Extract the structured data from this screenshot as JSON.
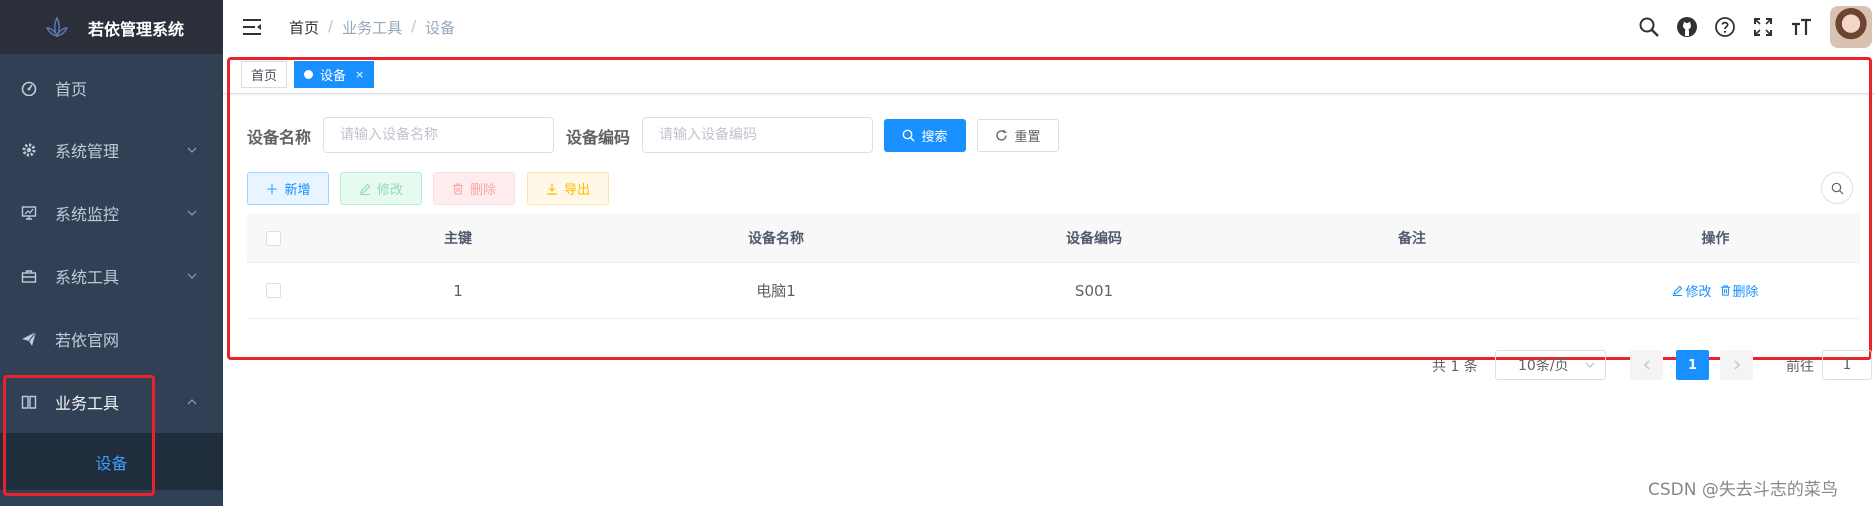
{
  "app": {
    "title": "若依管理系统"
  },
  "sidebar": {
    "items": [
      {
        "label": "首页",
        "icon": "dashboard-icon"
      },
      {
        "label": "系统管理",
        "icon": "gear-icon"
      },
      {
        "label": "系统监控",
        "icon": "monitor-icon"
      },
      {
        "label": "系统工具",
        "icon": "toolbox-icon"
      },
      {
        "label": "若依官网",
        "icon": "paper-plane-icon"
      },
      {
        "label": "业务工具",
        "icon": "book-icon",
        "expanded": true
      }
    ],
    "submenu": [
      {
        "label": "设备",
        "active": true
      }
    ]
  },
  "breadcrumb": [
    "首页",
    "业务工具",
    "设备"
  ],
  "tags": [
    {
      "label": "首页",
      "active": false
    },
    {
      "label": "设备",
      "active": true,
      "close": "×"
    }
  ],
  "search_form": {
    "name_label": "设备名称",
    "name_placeholder": "请输入设备名称",
    "code_label": "设备编码",
    "code_placeholder": "请输入设备编码",
    "search_button": "搜索",
    "reset_button": "重置"
  },
  "toolbar": {
    "add": "新增",
    "edit": "修改",
    "delete": "删除",
    "export": "导出"
  },
  "table": {
    "columns": [
      "主键",
      "设备名称",
      "设备编码",
      "备注",
      "操作"
    ],
    "rows": [
      {
        "id": "1",
        "name": "电脑1",
        "code": "S001",
        "remark": "",
        "edit": "修改",
        "delete": "删除"
      }
    ]
  },
  "pagination": {
    "total": "共 1 条",
    "page_size": "10条/页",
    "current_page": "1",
    "goto_label": "前往",
    "goto_value": "1"
  },
  "watermark": "CSDN @失去斗志的菜鸟",
  "colors": {
    "primary": "#1890ff",
    "sidebar_bg": "#304156",
    "highlight": "#e8232a"
  }
}
